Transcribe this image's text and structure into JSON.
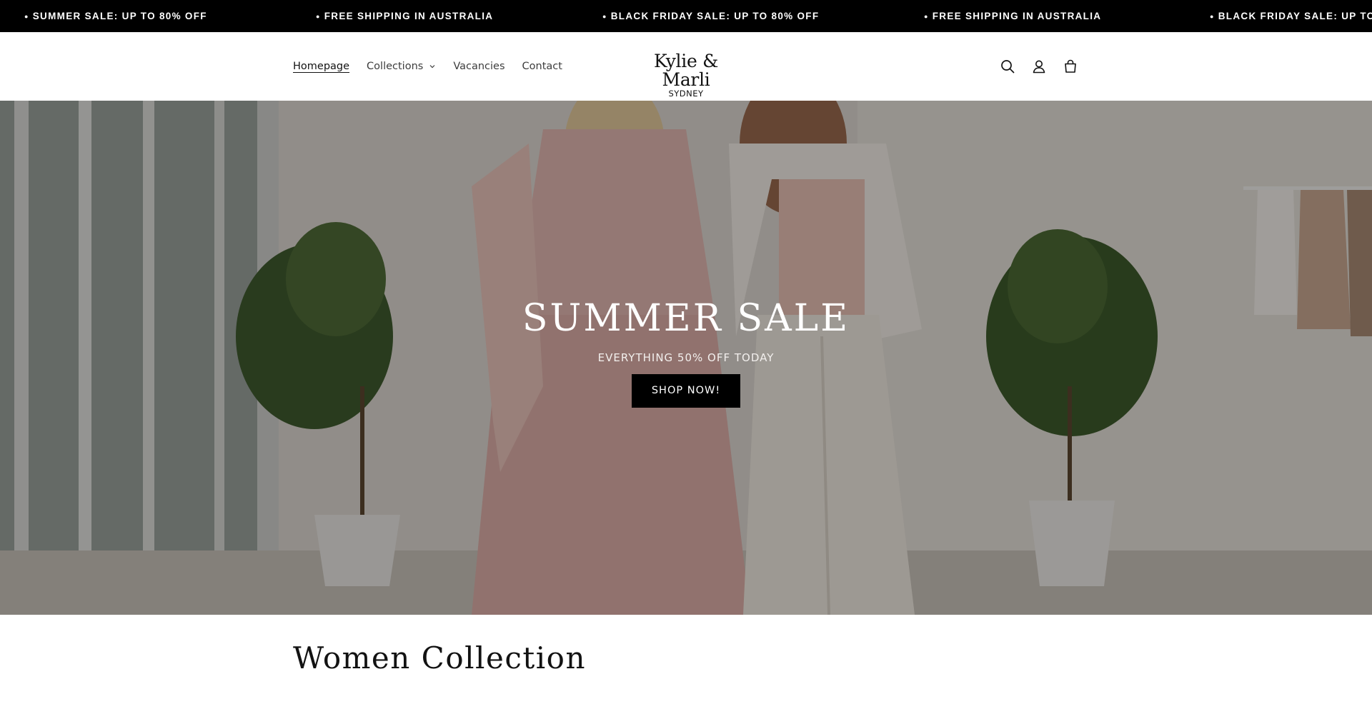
{
  "announcement_bar": {
    "items": [
      {
        "text": "SUMMER SALE: UP TO 80% OFF",
        "icon": "bullet-icon"
      },
      {
        "text": "FREE SHIPPING IN AUSTRALIA",
        "icon": "bullet-icon"
      },
      {
        "text": "BLACK FRIDAY SALE: UP TO 80% OFF",
        "icon": "bullet-icon"
      },
      {
        "text": "FREE SHIPPING IN AUSTRALIA",
        "icon": "bullet-icon"
      },
      {
        "text": "BLACK FRIDAY SALE: UP TO",
        "icon": "bullet-icon"
      }
    ],
    "background": "#000000",
    "text_color": "#ffffff"
  },
  "header": {
    "nav": [
      {
        "label": "Homepage",
        "active": true
      },
      {
        "label": "Collections",
        "has_dropdown": true,
        "icon": "chevron-down-icon"
      },
      {
        "label": "Vacancies"
      },
      {
        "label": "Contact"
      }
    ],
    "logo": {
      "name": "Kylie & Marli",
      "subtitle": "SYDNEY"
    },
    "icons": [
      "search-icon",
      "account-icon",
      "cart-icon"
    ]
  },
  "hero": {
    "title": "SUMMER SALE",
    "subtitle": "EVERYTHING 50% OFF TODAY",
    "button_label": "SHOP NOW!",
    "button_color": "#000000"
  },
  "section": {
    "title": "Women Collection"
  }
}
